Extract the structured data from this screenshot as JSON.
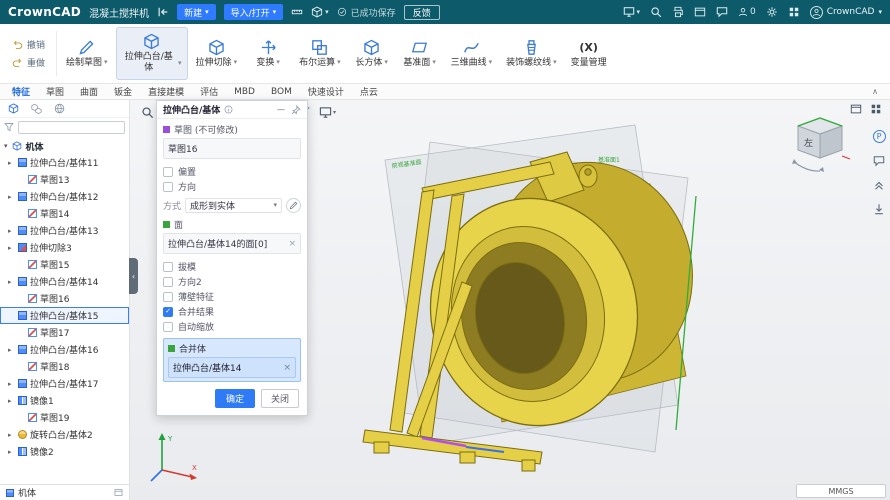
{
  "glyphs": {
    "caret": "▾",
    "expand": "▸",
    "collapse": "‹",
    "ribbon_collapse": "∧",
    "check": "✓",
    "clear": "×",
    "minimize": "—"
  },
  "topbar": {
    "logo": "CrownCAD",
    "doc_title": "混凝土搅拌机",
    "new_button": "新建",
    "import_button": "导入/打开",
    "save_status": "已成功保存",
    "feedback_button": "反馈",
    "online_count": "0",
    "account_label": "CrownCAD"
  },
  "ribbon": {
    "undo_label": "撤销",
    "redo_label": "重做",
    "tools": [
      {
        "label": "绘制草图",
        "icon": "pencil",
        "caret": true
      },
      {
        "label": "拉伸凸台/基体",
        "icon": "cube",
        "active": true
      },
      {
        "label": "拉伸切除",
        "icon": "cube"
      },
      {
        "label": "变换",
        "icon": "transform"
      },
      {
        "label": "布尔运算",
        "icon": "boolean"
      },
      {
        "label": "长方体",
        "icon": "cube"
      },
      {
        "label": "基准面",
        "icon": "plane"
      },
      {
        "label": "三维曲线",
        "icon": "curve"
      },
      {
        "label": "装饰螺纹线",
        "icon": "thread"
      },
      {
        "label": "变量管理",
        "icon": "none",
        "icon_text": "(X)",
        "nocaret": true
      }
    ]
  },
  "tabs": [
    {
      "label": "特征",
      "active": true
    },
    {
      "label": "草图"
    },
    {
      "label": "曲面"
    },
    {
      "label": "钣金"
    },
    {
      "label": "直接建模"
    },
    {
      "label": "评估"
    },
    {
      "label": "MBD"
    },
    {
      "label": "BOM"
    },
    {
      "label": "快速设计"
    },
    {
      "label": "点云"
    }
  ],
  "tree": {
    "root_label": "机体",
    "items": [
      {
        "label": "拉伸凸台/基体11",
        "type": "extrude",
        "arrow": true
      },
      {
        "label": "草图13",
        "type": "sketch",
        "indent": true
      },
      {
        "label": "拉伸凸台/基体12",
        "type": "extrude",
        "arrow": true
      },
      {
        "label": "草图14",
        "type": "sketch",
        "indent": true
      },
      {
        "label": "拉伸凸台/基体13",
        "type": "extrude",
        "arrow": true
      },
      {
        "label": "拉伸切除3",
        "type": "cut",
        "arrow": true
      },
      {
        "label": "草图15",
        "type": "sketch",
        "indent": true
      },
      {
        "label": "拉伸凸台/基体14",
        "type": "extrude",
        "arrow": true
      },
      {
        "label": "草图16",
        "type": "sketch",
        "indent": true
      },
      {
        "label": "拉伸凸台/基体15",
        "type": "extrude",
        "selected": true
      },
      {
        "label": "草图17",
        "type": "sketch",
        "indent": true
      },
      {
        "label": "拉伸凸台/基体16",
        "type": "extrude",
        "arrow": true
      },
      {
        "label": "草图18",
        "type": "sketch",
        "indent": true
      },
      {
        "label": "拉伸凸台/基体17",
        "type": "extrude",
        "arrow": true
      },
      {
        "label": "镜像1",
        "type": "mirror",
        "arrow": true
      },
      {
        "label": "草图19",
        "type": "sketch",
        "indent": true
      },
      {
        "label": "旋转凸台/基体2",
        "type": "revolve",
        "arrow": true
      },
      {
        "label": "镜像2",
        "type": "mirror",
        "arrow": true
      }
    ],
    "bottom_tab": "机体"
  },
  "dialog": {
    "title": "拉伸凸台/基体",
    "sketch_label": "草图 (不可修改)",
    "sketch_value": "草图16",
    "checkbox_offset": "偏置",
    "checkbox_direction": "方向",
    "method_label": "方式",
    "method_value": "成形到实体",
    "face_label": "面",
    "face_value": "拉伸凸台/基体14的面[0]",
    "checkbox_draft": "拔模",
    "checkbox_direction2": "方向2",
    "checkbox_thinwall": "薄壁特征",
    "checkbox_merge_result": "合并结果",
    "checkbox_autoscale": "自动缩放",
    "merge_label": "合并体",
    "merge_value": "拉伸凸台/基体14",
    "ok_button": "确定",
    "close_button": "关闭"
  },
  "viewport": {
    "units": "MMGS",
    "view_cube_face": "左",
    "plane_label_front": "前视基准面",
    "plane_label_datum": "基准面1",
    "axis_x": "X",
    "axis_y": "Y",
    "right_badge": "P"
  }
}
